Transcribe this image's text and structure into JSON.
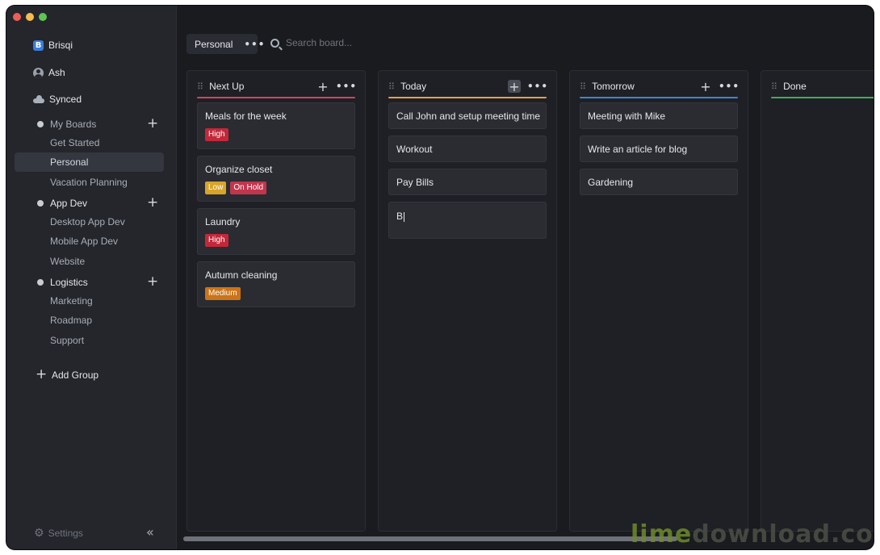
{
  "sidebar": {
    "brand": "Brisqi",
    "user": "Ash",
    "sync_status": "Synced",
    "groups": [
      {
        "label": "My Boards",
        "items": [
          "Get Started",
          "Personal",
          "Vacation Planning"
        ]
      },
      {
        "label": "App Dev",
        "items": [
          "Desktop App Dev",
          "Mobile App Dev",
          "Website"
        ]
      },
      {
        "label": "Logistics",
        "items": [
          "Marketing",
          "Roadmap",
          "Support"
        ]
      }
    ],
    "active_item": "Personal",
    "add_group": "Add Group",
    "settings": "Settings"
  },
  "topbar": {
    "board_name": "Personal",
    "search_placeholder": "Search board..."
  },
  "columns": [
    {
      "title": "Next Up",
      "accent": "#d6435a",
      "cards": [
        {
          "title": "Meals for the week",
          "badges": [
            {
              "label": "High",
              "color": "#c2283a"
            }
          ]
        },
        {
          "title": "Organize closet",
          "badges": [
            {
              "label": "Low",
              "color": "#d8a42b"
            },
            {
              "label": "On Hold",
              "color": "#c2354d"
            }
          ]
        },
        {
          "title": "Laundry",
          "badges": [
            {
              "label": "High",
              "color": "#c2283a"
            }
          ]
        },
        {
          "title": "Autumn cleaning",
          "badges": [
            {
              "label": "Medium",
              "color": "#cc7418"
            }
          ]
        }
      ]
    },
    {
      "title": "Today",
      "accent": "#e6a04a",
      "cards": [
        {
          "title": "Call John and setup meeting time"
        },
        {
          "title": "Workout"
        },
        {
          "title": "Pay Bills"
        }
      ],
      "draft_card": "B"
    },
    {
      "title": "Tomorrow",
      "accent": "#3d86d6",
      "cards": [
        {
          "title": "Meeting with Mike"
        },
        {
          "title": "Write an article for blog"
        },
        {
          "title": "Gardening"
        }
      ]
    },
    {
      "title": "Done",
      "accent": "#3fae5a",
      "cards": []
    }
  ],
  "watermark": {
    "part1": "lime",
    "part2": "download.com"
  }
}
